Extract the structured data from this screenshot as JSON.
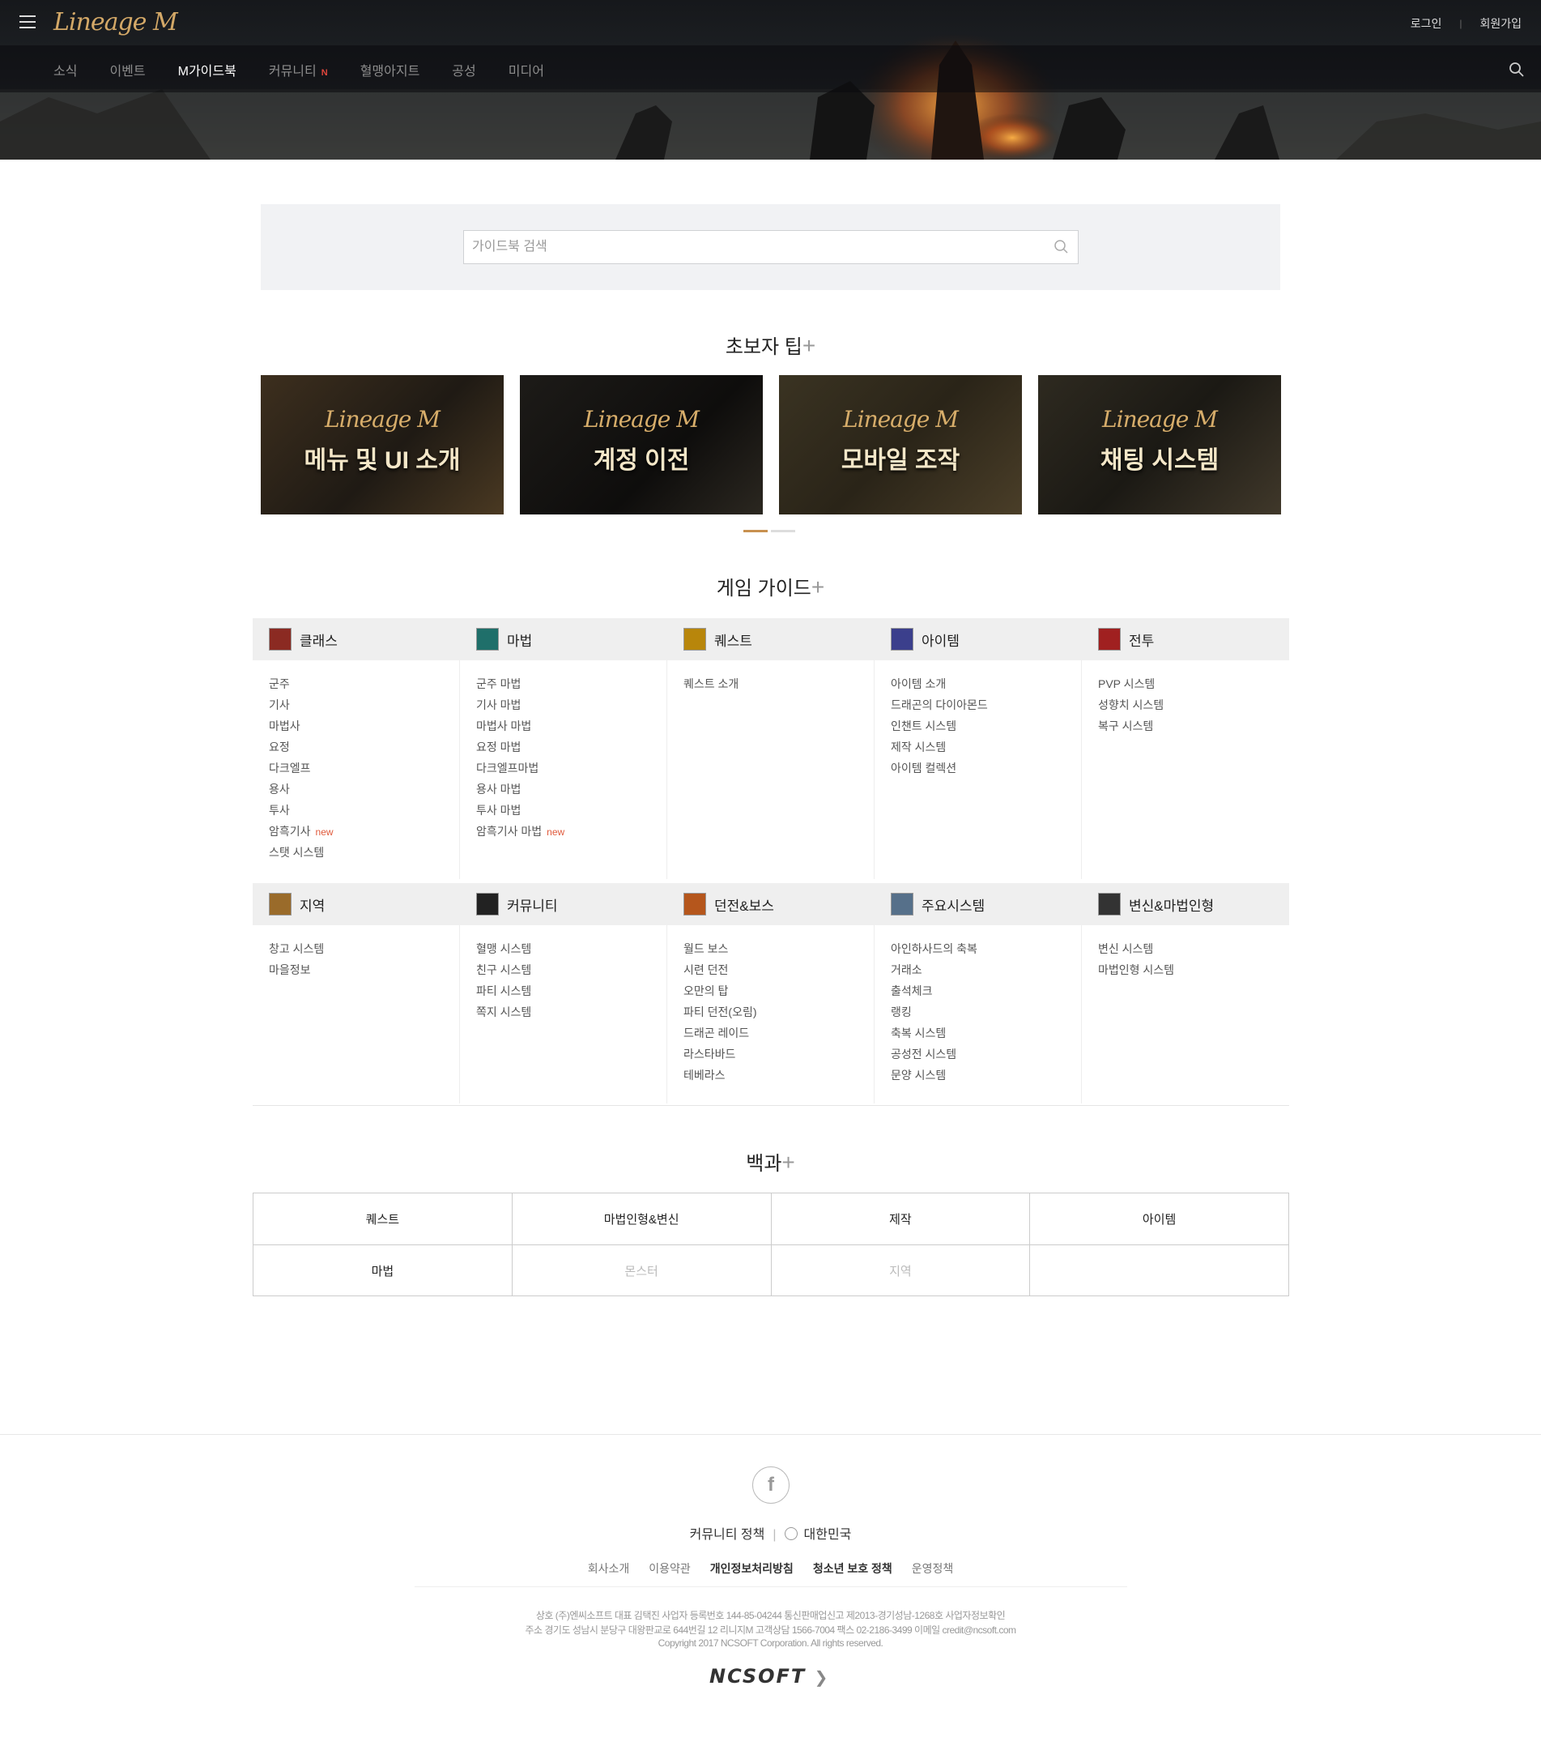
{
  "header": {
    "logo_text": "Lineage M",
    "login": "로그인",
    "signup": "회원가입",
    "nav": [
      {
        "label": "소식",
        "active": false,
        "badge": ""
      },
      {
        "label": "이벤트",
        "active": false,
        "badge": ""
      },
      {
        "label": "M가이드북",
        "active": true,
        "badge": ""
      },
      {
        "label": "커뮤니티",
        "active": false,
        "badge": "N"
      },
      {
        "label": "혈맹아지트",
        "active": false,
        "badge": ""
      },
      {
        "label": "공성",
        "active": false,
        "badge": ""
      },
      {
        "label": "미디어",
        "active": false,
        "badge": ""
      }
    ]
  },
  "search": {
    "placeholder": "가이드북 검색",
    "value": ""
  },
  "tips": {
    "title": "초보자 팁",
    "plus": "+",
    "cards": [
      {
        "logo": "Lineage M",
        "title": "메뉴 및 UI 소개"
      },
      {
        "logo": "Lineage M",
        "title": "계정 이전"
      },
      {
        "logo": "Lineage M",
        "title": "모바일 조작"
      },
      {
        "logo": "Lineage M",
        "title": "채팅 시스템"
      }
    ],
    "pagination": {
      "pages": 2,
      "current": 1
    }
  },
  "guide": {
    "title": "게임 가이드",
    "plus": "+",
    "new_label": "new",
    "row1": [
      {
        "label": "클래스",
        "icon": "class-icon",
        "items": [
          {
            "t": "군주"
          },
          {
            "t": "기사"
          },
          {
            "t": "마법사"
          },
          {
            "t": "요정"
          },
          {
            "t": "다크엘프"
          },
          {
            "t": "용사"
          },
          {
            "t": "투사"
          },
          {
            "t": "암흑기사",
            "new": true
          },
          {
            "t": "스탯 시스템"
          }
        ]
      },
      {
        "label": "마법",
        "icon": "magic-icon",
        "items": [
          {
            "t": "군주 마법"
          },
          {
            "t": "기사 마법"
          },
          {
            "t": "마법사 마법"
          },
          {
            "t": "요정 마법"
          },
          {
            "t": "다크엘프마법"
          },
          {
            "t": "용사 마법"
          },
          {
            "t": "투사 마법"
          },
          {
            "t": "암흑기사 마법",
            "new": true
          }
        ]
      },
      {
        "label": "퀘스트",
        "icon": "quest-icon",
        "items": [
          {
            "t": "퀘스트 소개"
          }
        ]
      },
      {
        "label": "아이템",
        "icon": "item-icon",
        "items": [
          {
            "t": "아이템 소개"
          },
          {
            "t": "드래곤의 다이아몬드"
          },
          {
            "t": "인챈트 시스템"
          },
          {
            "t": "제작 시스템"
          },
          {
            "t": "아이템 컬렉션"
          }
        ]
      },
      {
        "label": "전투",
        "icon": "battle-icon",
        "items": [
          {
            "t": "PVP 시스템"
          },
          {
            "t": "성향치 시스템"
          },
          {
            "t": "복구 시스템"
          }
        ]
      }
    ],
    "row2": [
      {
        "label": "지역",
        "icon": "region-icon",
        "items": [
          {
            "t": "창고 시스템"
          },
          {
            "t": "마을정보"
          }
        ]
      },
      {
        "label": "커뮤니티",
        "icon": "community-icon",
        "items": [
          {
            "t": "혈맹 시스템"
          },
          {
            "t": "친구 시스템"
          },
          {
            "t": "파티 시스템"
          },
          {
            "t": "쪽지 시스템"
          }
        ]
      },
      {
        "label": "던전&보스",
        "icon": "dungeon-icon",
        "items": [
          {
            "t": "월드 보스"
          },
          {
            "t": "시련 던전"
          },
          {
            "t": "오만의 탑"
          },
          {
            "t": "파티 던전(오림)"
          },
          {
            "t": "드래곤 레이드"
          },
          {
            "t": "라스타바드"
          },
          {
            "t": "테베라스"
          }
        ]
      },
      {
        "label": "주요시스템",
        "icon": "system-icon",
        "items": [
          {
            "t": "아인하사드의 축복"
          },
          {
            "t": "거래소"
          },
          {
            "t": "출석체크"
          },
          {
            "t": "랭킹"
          },
          {
            "t": "축복 시스템"
          },
          {
            "t": "공성전 시스템"
          },
          {
            "t": "문양 시스템"
          }
        ]
      },
      {
        "label": "변신&마법인형",
        "icon": "polymorph-icon",
        "items": [
          {
            "t": "변신 시스템"
          },
          {
            "t": "마법인형 시스템"
          }
        ]
      }
    ]
  },
  "encyclopedia": {
    "title": "백과",
    "plus": "+",
    "rows": [
      [
        {
          "t": "퀘스트",
          "dim": false
        },
        {
          "t": "마법인형&변신",
          "dim": false
        },
        {
          "t": "제작",
          "dim": false
        },
        {
          "t": "아이템",
          "dim": false
        }
      ],
      [
        {
          "t": "마법",
          "dim": false
        },
        {
          "t": "몬스터",
          "dim": true
        },
        {
          "t": "지역",
          "dim": true
        },
        {
          "t": "",
          "dim": false
        }
      ]
    ]
  },
  "footer": {
    "facebook": "f",
    "community_policy": "커뮤니티 정책",
    "region": "대한민국",
    "links": [
      {
        "t": "회사소개",
        "bold": false
      },
      {
        "t": "이용약관",
        "bold": false
      },
      {
        "t": "개인정보처리방침",
        "bold": true
      },
      {
        "t": "청소년 보호 정책",
        "bold": true
      },
      {
        "t": "운영정책",
        "bold": false
      }
    ],
    "corp_line1": "상호 (주)엔씨소프트 대표 김택진 사업자 등록번호 144-85-04244 통신판매업신고 제2013-경기성남-1268호 사업자정보확인",
    "corp_line2": "주소 경기도 성남시 분당구 대왕판교로 644번길 12 리니지M 고객상담 1566-7004 팩스 02-2186-3499 이메일 credit@ncsoft.com",
    "corp_line3": "Copyright 2017 NCSOFT Corporation. All rights reserved.",
    "brand": "NCSOFT"
  }
}
